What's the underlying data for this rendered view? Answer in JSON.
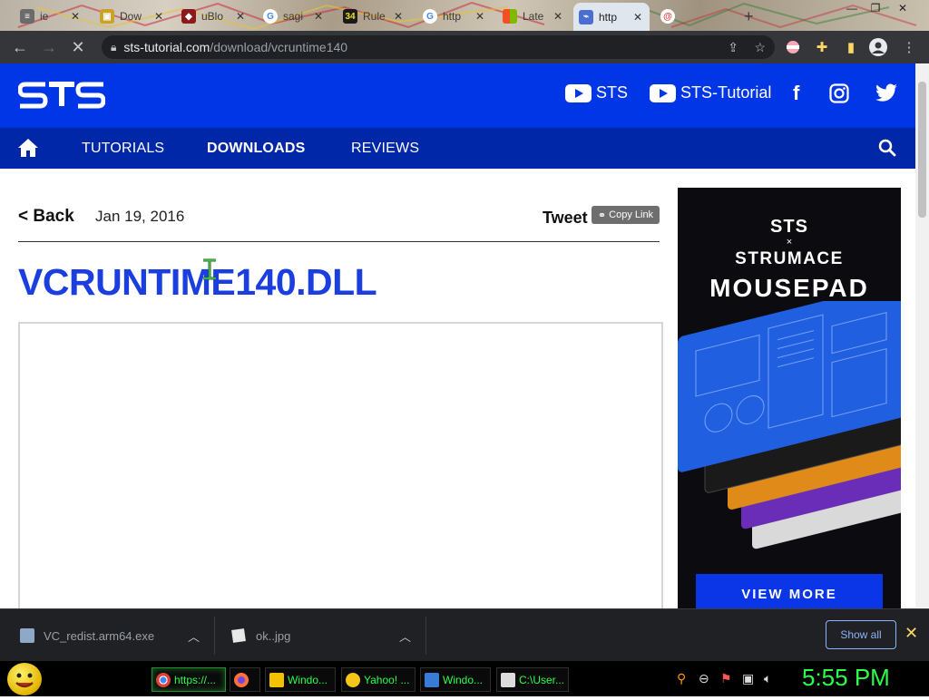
{
  "browser": {
    "tabs": [
      {
        "title": "ie",
        "icon": "document-icon",
        "color": "#6b6b6b"
      },
      {
        "title": "Dow",
        "icon": "box-icon",
        "color": "#c9a227"
      },
      {
        "title": "uBlo",
        "icon": "shield-icon",
        "color": "#8b1a1a"
      },
      {
        "title": "sagi",
        "icon": "google-icon",
        "color": "#4285f4"
      },
      {
        "title": "Rule",
        "icon": "number-icon",
        "color": "#1a1a1a"
      },
      {
        "title": "http",
        "icon": "google-icon",
        "color": "#4285f4"
      },
      {
        "title": "Late",
        "icon": "windows-icon",
        "color": "#f25022"
      },
      {
        "title": "http",
        "icon": "page-icon",
        "color": "#4a6fd1",
        "active": true
      },
      {
        "title": "",
        "icon": "at-icon",
        "color": "#e34040"
      }
    ],
    "address_host": "sts-tutorial.com",
    "address_path": "/download/vcruntime140"
  },
  "site": {
    "logo": "STS",
    "social": [
      {
        "label": "STS",
        "icon": "youtube-icon"
      },
      {
        "label": "STS-Tutorial",
        "icon": "youtube-icon"
      }
    ],
    "nav": {
      "tutorials": "TUTORIALS",
      "downloads": "DOWNLOADS",
      "reviews": "REVIEWS"
    }
  },
  "article": {
    "back": "< Back",
    "date": "Jan 19, 2016",
    "tweet": "Tweet",
    "copy_link": "Copy Link",
    "title": "VCRUNTIME140.DLL"
  },
  "ad": {
    "sts": "STS",
    "x": "×",
    "brand": "STRUMACE",
    "headline": "MOUSEPAD",
    "cta": "VIEW MORE",
    "colors": [
      "#1f5fe0",
      "#1a1a1a",
      "#e08a1a",
      "#6a2db8",
      "#d9d9d9"
    ]
  },
  "downloads": {
    "items": [
      "VC_redist.arm64.exe",
      "ok..jpg"
    ],
    "show_all": "Show all"
  },
  "taskbar": {
    "items": [
      {
        "label": "https://...",
        "color": "#4285f4",
        "active": true
      },
      {
        "label": "",
        "color": "#ff7139"
      },
      {
        "label": "Windo...",
        "color": "#f2c200"
      },
      {
        "label": "Yahoo! ...",
        "color": "#f5c518"
      },
      {
        "label": "Windo...",
        "color": "#3a7bd5"
      },
      {
        "label": "C:\\User...",
        "color": "#dcdcdc"
      }
    ],
    "clock": "5:55 PM"
  }
}
